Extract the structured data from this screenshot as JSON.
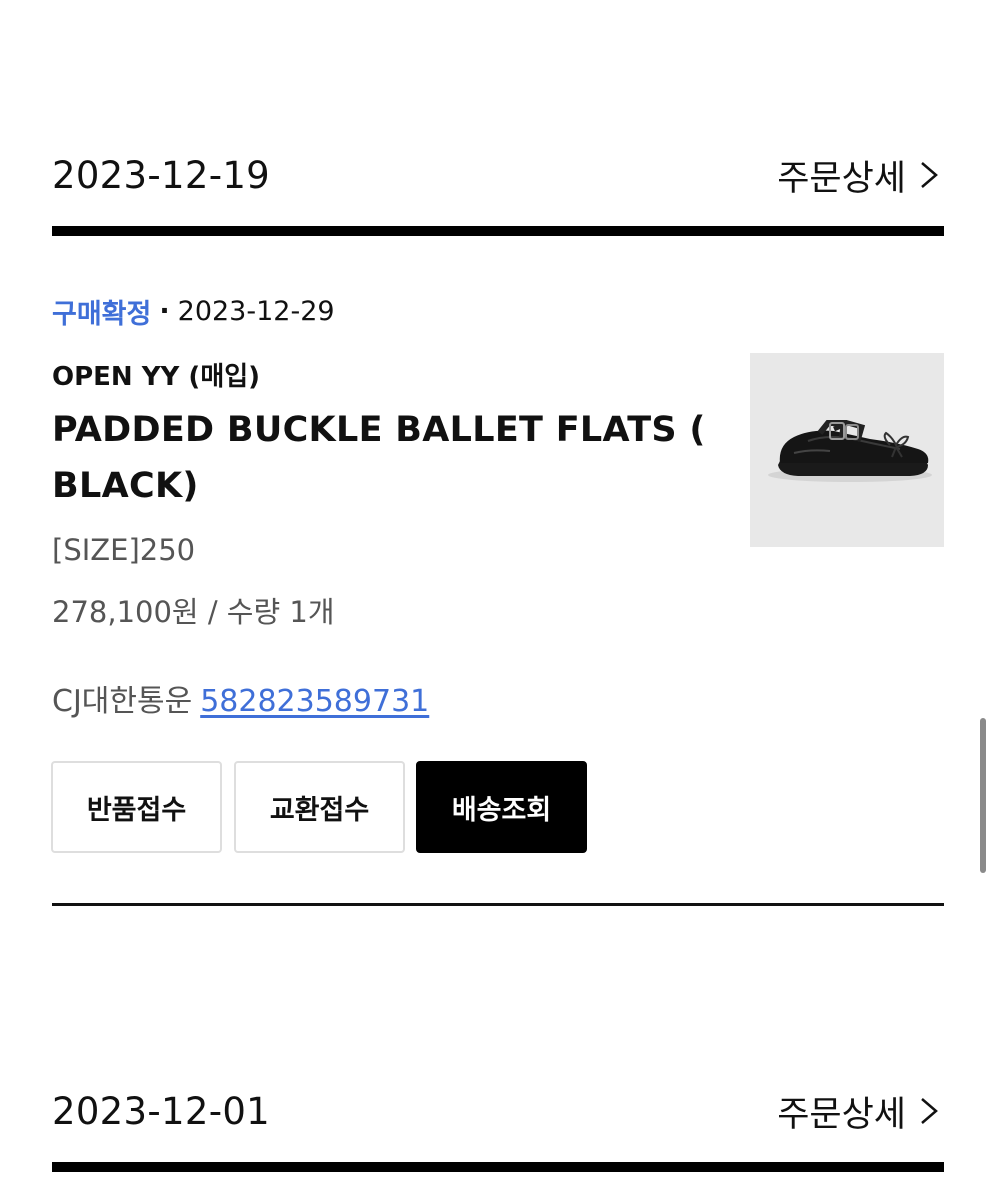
{
  "orders": [
    {
      "date": "2023-12-19",
      "detail_label": "주문상세",
      "status": "구매확정",
      "separator": "·",
      "status_date": "2023-12-29",
      "brand": "OPEN YY (매입)",
      "product_name": "PADDED BUCKLE BALLET FLATS ( BLACK)",
      "option": "[SIZE]250",
      "price_qty": "278,100원 / 수량 1개",
      "courier": "CJ대한통운",
      "tracking_number": "582823589731",
      "buttons": {
        "return": "반품접수",
        "exchange": "교환접수",
        "tracking": "배송조회"
      },
      "product_image_icon": "black-ballet-flat-shoe-image"
    },
    {
      "date": "2023-12-01",
      "detail_label": "주문상세"
    }
  ],
  "colors": {
    "accent_blue": "#3f6fd8",
    "text_dark": "#111111",
    "text_gray": "#555555",
    "image_bg": "#e8e8e8"
  },
  "icons": {
    "detail_chevron": "chevron-right-icon"
  }
}
